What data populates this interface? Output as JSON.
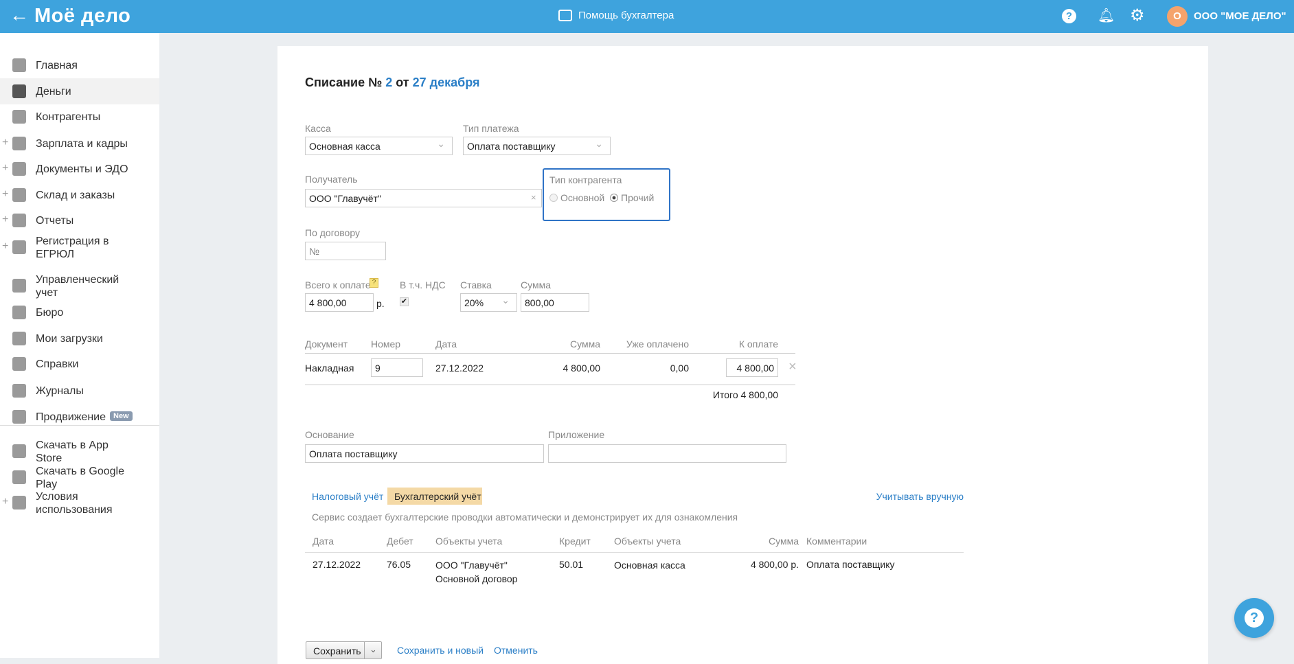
{
  "header": {
    "logo": "Моё дело",
    "help_center": "Помощь бухгалтера",
    "company": "ООО \"МОЕ ДЕЛО\"",
    "avatar_letter": "О"
  },
  "sidebar": {
    "items": [
      {
        "label": "Главная",
        "icon": "home-icon"
      },
      {
        "label": "Деньги",
        "icon": "money-icon",
        "active": true
      },
      {
        "label": "Контрагенты",
        "icon": "contractors-icon"
      },
      {
        "label": "Зарплата и кадры",
        "icon": "wallet-icon",
        "plus": true
      },
      {
        "label": "Документы и ЭДО",
        "icon": "folder-icon",
        "plus": true
      },
      {
        "label": "Склад и заказы",
        "icon": "warehouse-icon",
        "plus": true
      },
      {
        "label": "Отчеты",
        "icon": "report-icon",
        "plus": true
      },
      {
        "label": "Регистрация в ЕГРЮЛ",
        "icon": "registration-icon",
        "plus": true
      },
      {
        "label": "Управленческий учет",
        "icon": "management-icon"
      },
      {
        "label": "Бюро",
        "icon": "briefcase-icon"
      },
      {
        "label": "Мои загрузки",
        "icon": "folder-icon"
      },
      {
        "label": "Справки",
        "icon": "reference-icon"
      },
      {
        "label": "Журналы",
        "icon": "journal-icon"
      },
      {
        "label": "Продвижение",
        "icon": "promotion-icon",
        "badge": "New"
      }
    ],
    "bottom": [
      {
        "label": "Скачать в App Store",
        "icon": "apple-icon"
      },
      {
        "label": "Скачать в Google Play",
        "icon": "google-play-icon"
      },
      {
        "label": "Условия использования",
        "icon": "more-icon",
        "plus": true
      }
    ]
  },
  "form": {
    "title_prefix": "Списание №",
    "number": "2",
    "title_from": "от",
    "date": "27 декабря",
    "kassa_label": "Касса",
    "kassa_value": "Основная касса",
    "payment_type_label": "Тип платежа",
    "payment_type_value": "Оплата поставщику",
    "recipient_label": "Получатель",
    "recipient_value": "ООО \"Главучёт\"",
    "contractor_type_label": "Тип контрагента",
    "contractor_type_options": [
      "Основной",
      "Прочий"
    ],
    "contractor_type_selected": "Прочий",
    "contract_label": "По договору",
    "contract_placeholder": "№",
    "total_label": "Всего к оплате",
    "total_help": "?",
    "total_value": "4 800,00",
    "currency": "р.",
    "vat_label": "В т.ч. НДС",
    "vat_checked": true,
    "rate_label": "Ставка",
    "rate_value": "20%",
    "sum_label": "Сумма",
    "sum_value": "800,00",
    "docs": {
      "headers": [
        "Документ",
        "Номер",
        "Дата",
        "Сумма",
        "Уже оплачено",
        "К оплате"
      ],
      "rows": [
        {
          "doc": "Накладная",
          "number": "9",
          "date": "27.12.2022",
          "sum": "4 800,00",
          "paid": "0,00",
          "to_pay": "4 800,00"
        }
      ],
      "total": "Итого 4 800,00"
    },
    "basis_label": "Основание",
    "basis_value": "Оплата поставщику",
    "attachment_label": "Приложение",
    "attachment_value": ""
  },
  "accounting": {
    "tabs": [
      "Налоговый учёт",
      "Бухгалтерский учёт"
    ],
    "active_tab": "Бухгалтерский учёт",
    "manual_link": "Учитывать вручную",
    "description": "Сервис создает бухгалтерские проводки автоматически и демонстрирует их для ознакомления",
    "headers": [
      "Дата",
      "Дебет",
      "Объекты учета",
      "Кредит",
      "Объекты учета",
      "Сумма",
      "Комментарии"
    ],
    "rows": [
      {
        "date": "27.12.2022",
        "debit": "76.05",
        "debit_obj1": "ООО \"Главучёт\"",
        "debit_obj2": "Основной договор",
        "credit": "50.01",
        "credit_obj": "Основная касса",
        "sum": "4 800,00 р.",
        "comment": "Оплата поставщику"
      }
    ]
  },
  "actions": {
    "save": "Сохранить",
    "save_new": "Сохранить и новый",
    "cancel": "Отменить"
  },
  "colors": {
    "header": "#3ea3dd",
    "accent": "#2b7fc7",
    "tab_active": "#f4d9a6",
    "avatar": "#f5a36c",
    "highlight_border": "#2f73c6"
  }
}
